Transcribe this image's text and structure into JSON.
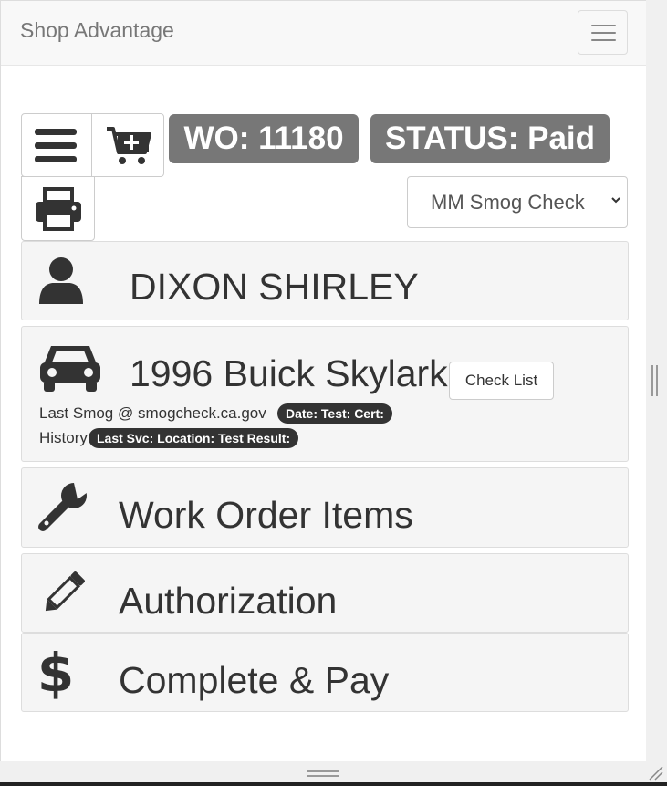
{
  "app": {
    "brand": "Shop Advantage"
  },
  "navbar": {
    "toggle_icon": "hamburger-icon"
  },
  "toolbar": {
    "menu_icon": "bars-icon",
    "cart_icon": "cart-plus-icon",
    "print_icon": "print-icon"
  },
  "work_order": {
    "number_label": "WO: 11180",
    "status_label": "STATUS: Paid"
  },
  "inspection_select": {
    "selected": "MM Smog Check"
  },
  "customer": {
    "name": "DIXON SHIRLEY",
    "icon": "user-icon"
  },
  "vehicle": {
    "title": "1996 Buick Skylark",
    "icon": "car-icon",
    "check_list_label": "Check List",
    "last_smog_text": "Last Smog @ smogcheck.ca.gov",
    "last_smog_badge": "Date: Test: Cert:",
    "history_text": "History",
    "history_badge": "Last Svc: Location: Test Result:"
  },
  "sections": {
    "work_order_items": {
      "label": "Work Order Items",
      "icon": "wrench-icon"
    },
    "authorization": {
      "label": "Authorization",
      "icon": "pencil-icon"
    },
    "complete_pay": {
      "label": "Complete & Pay",
      "icon": "dollar-icon"
    }
  },
  "colors": {
    "badge_gray": "#777777",
    "dark_pill": "#333333",
    "panel_bg": "#f5f5f5",
    "icon_dark": "#333333"
  }
}
